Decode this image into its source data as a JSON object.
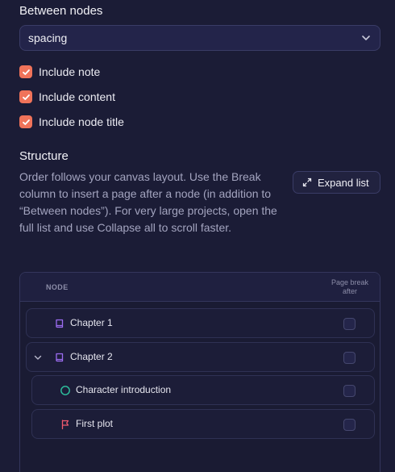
{
  "between_nodes": {
    "label": "Between nodes",
    "selected": "spacing"
  },
  "options": [
    {
      "label": "Include note",
      "checked": true
    },
    {
      "label": "Include content",
      "checked": true
    },
    {
      "label": "Include node title",
      "checked": true
    }
  ],
  "structure": {
    "title": "Structure",
    "description": "Order follows your canvas layout. Use the Break column to insert a page after a node (in addition to “Between nodes”). For very large projects, open the full list and use Collapse all to scroll faster.",
    "expand_label": "Expand list"
  },
  "table": {
    "col_node": "NODE",
    "col_break": "Page break after",
    "rows": [
      {
        "label": "Chapter 1",
        "icon": "book-icon",
        "break_after": false
      },
      {
        "label": "Chapter 2",
        "icon": "book-icon",
        "expanded": true,
        "break_after": false
      },
      {
        "label": "Character introduction",
        "icon": "circle-icon",
        "break_after": false
      },
      {
        "label": "First plot",
        "icon": "flag-icon",
        "break_after": false
      }
    ]
  },
  "colors": {
    "accent": "#f0735a",
    "background": "#1b1c36",
    "book_icon": "#9b6cf0",
    "circle_icon": "#2ec4a0",
    "flag_icon": "#f05a6e"
  }
}
